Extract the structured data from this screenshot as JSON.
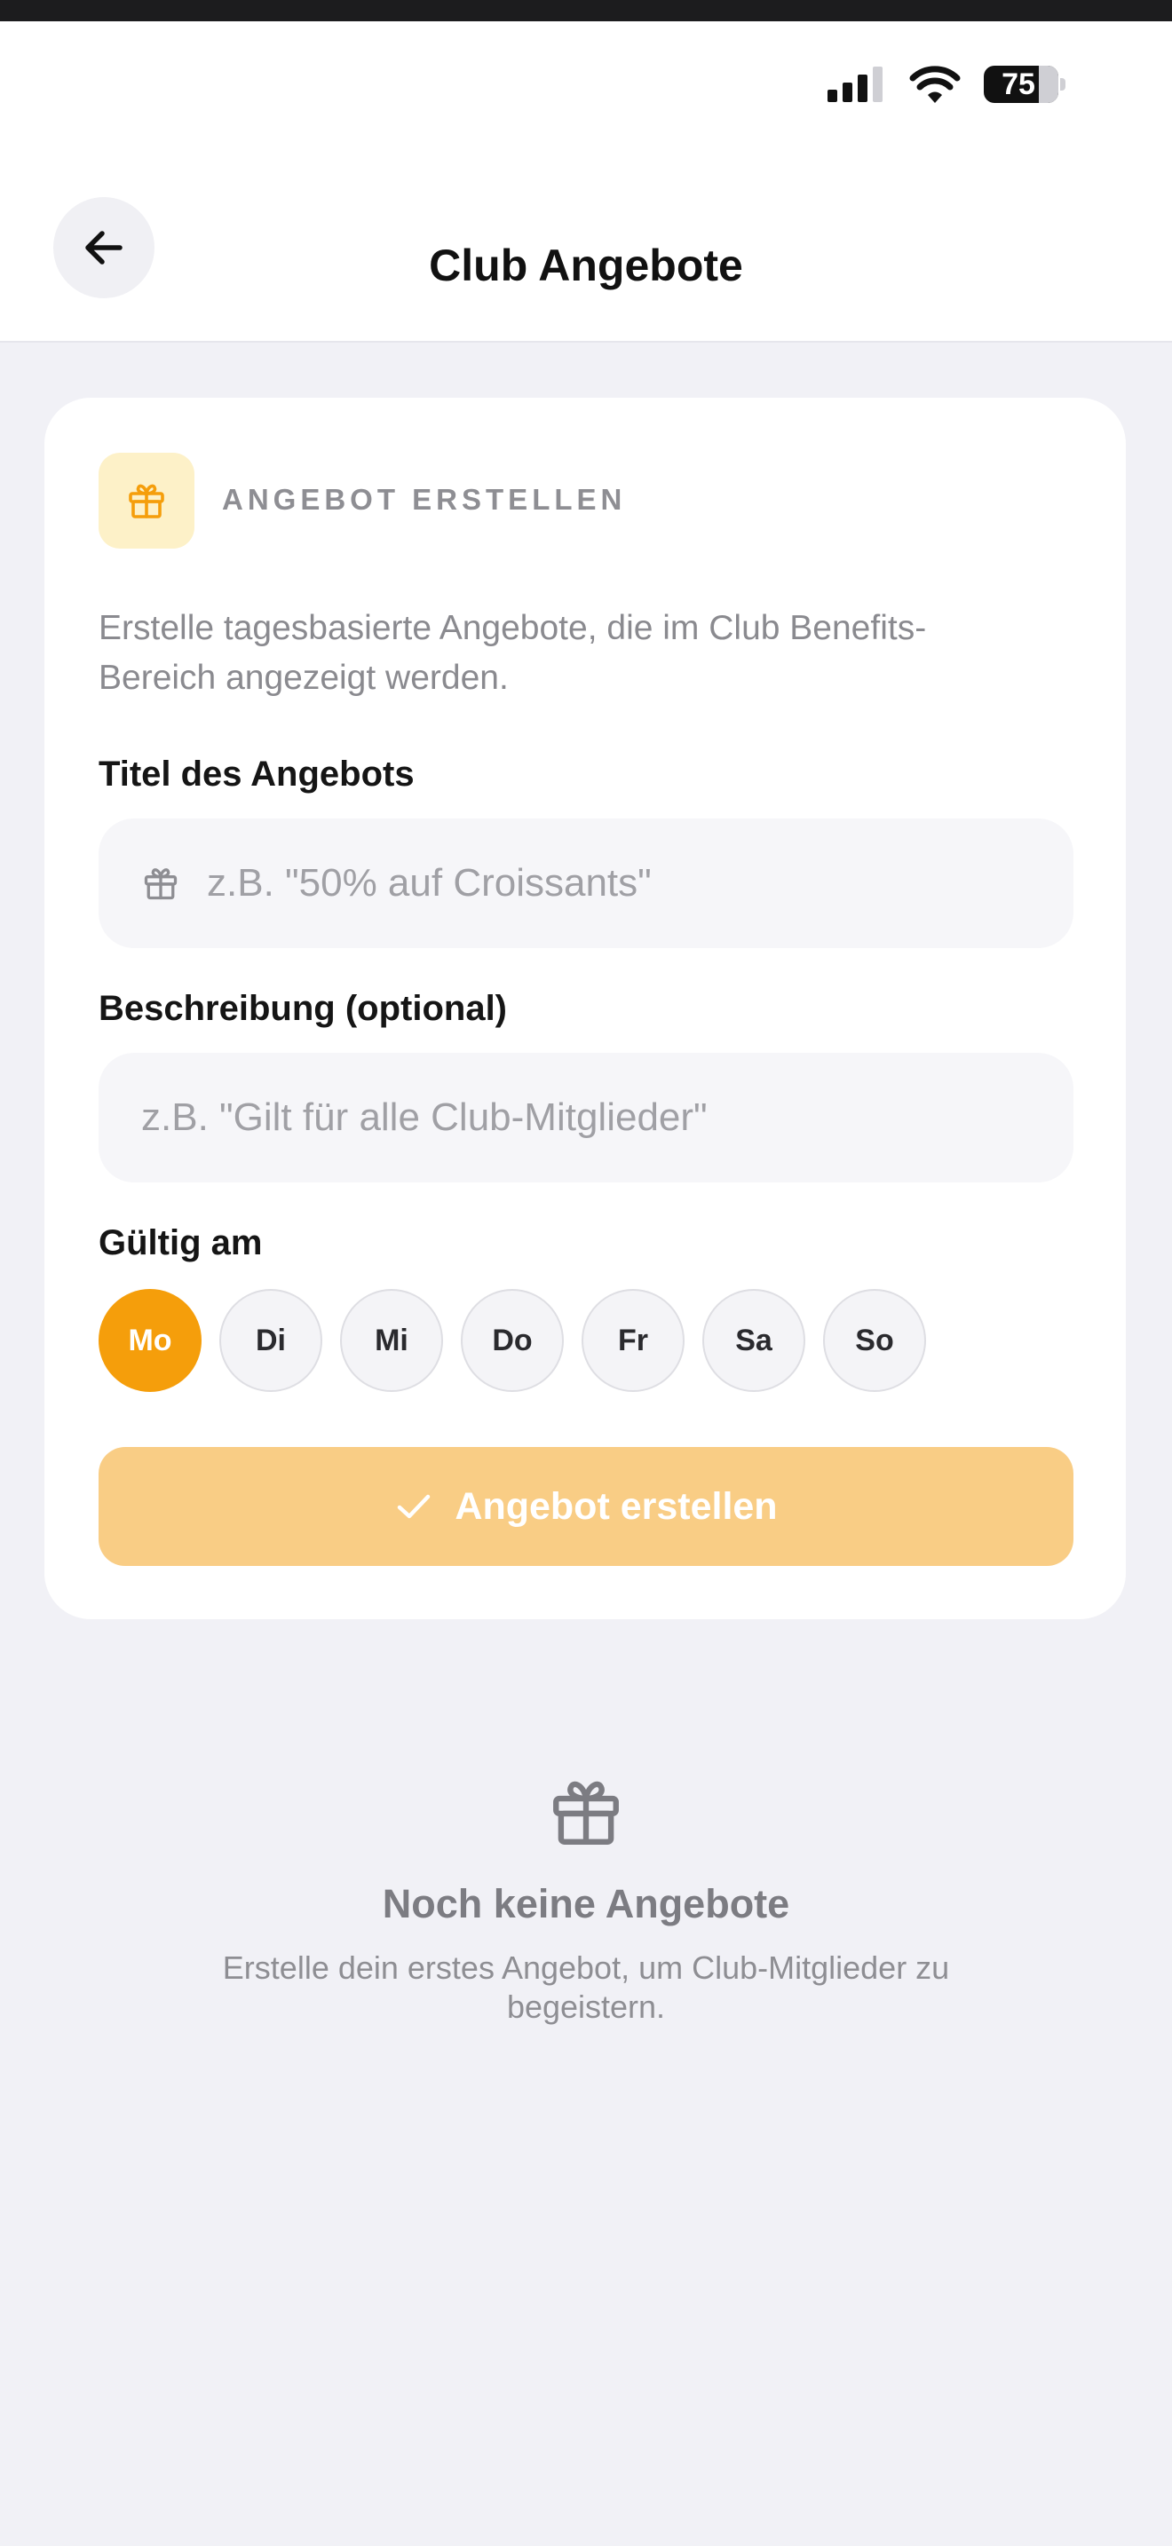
{
  "status_bar": {
    "battery": "75"
  },
  "header": {
    "title": "Club Angebote"
  },
  "card": {
    "section_label": "ANGEBOT ERSTELLEN",
    "description": "Erstelle tagesbasierte Angebote, die im Club Benefits-Bereich angezeigt werden.",
    "title_field": {
      "label": "Titel des Angebots",
      "placeholder": "z.B. \"50% auf Croissants\"",
      "icon": "gift-icon"
    },
    "description_field": {
      "label": "Beschreibung (optional)",
      "placeholder": "z.B. \"Gilt für alle Club-Mitglieder\""
    },
    "valid_on": {
      "label": "Gültig am",
      "days": [
        {
          "label": "Mo",
          "selected": true
        },
        {
          "label": "Di",
          "selected": false
        },
        {
          "label": "Mi",
          "selected": false
        },
        {
          "label": "Do",
          "selected": false
        },
        {
          "label": "Fr",
          "selected": false
        },
        {
          "label": "Sa",
          "selected": false
        },
        {
          "label": "So",
          "selected": false
        }
      ]
    },
    "submit_button": {
      "label": "Angebot erstellen",
      "icon": "check-icon"
    }
  },
  "empty_state": {
    "icon": "gift-icon",
    "title": "Noch keine Angebote",
    "text": "Erstelle dein erstes Angebot, um Club-Mitglieder zu begeistern."
  },
  "colors": {
    "accent": "#f59e0b",
    "accent_light": "#fdf1c8",
    "button_disabled": "#f9cd85",
    "background": "#f1f1f6"
  }
}
